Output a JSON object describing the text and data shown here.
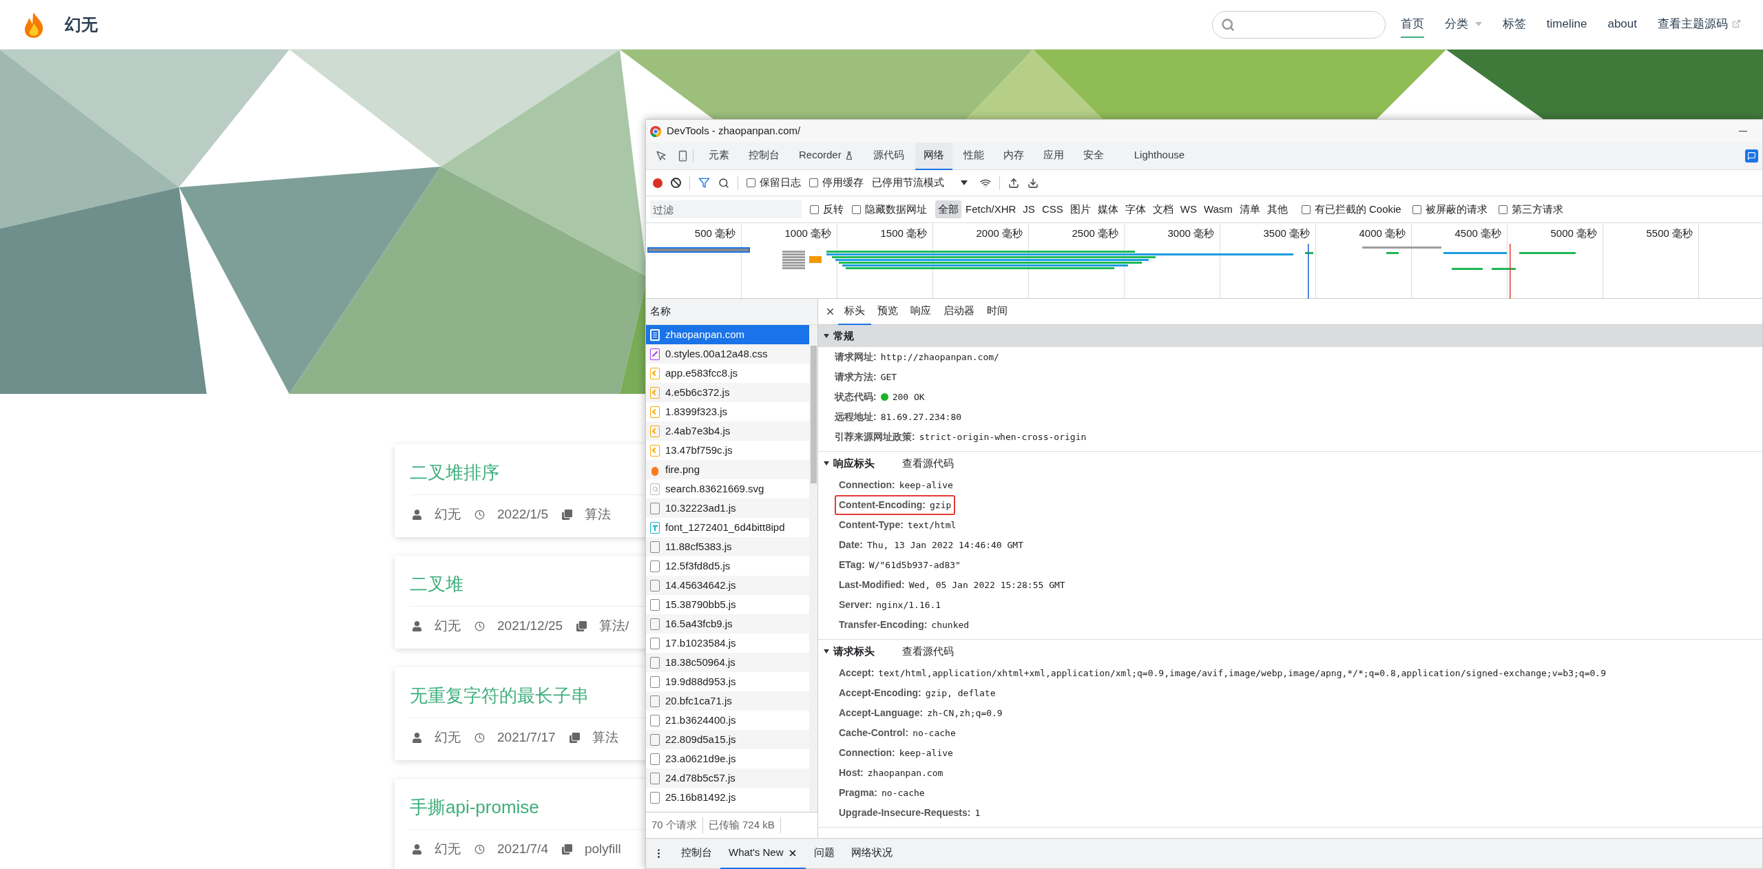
{
  "site": {
    "title": "幻无",
    "nav": [
      {
        "label": "首页",
        "selected": true,
        "kind": "link"
      },
      {
        "label": "分类",
        "selected": false,
        "kind": "dropdown"
      },
      {
        "label": "标签",
        "selected": false,
        "kind": "link"
      },
      {
        "label": "timeline",
        "selected": false,
        "kind": "link"
      },
      {
        "label": "about",
        "selected": false,
        "kind": "link"
      },
      {
        "label": "查看主题源码",
        "selected": false,
        "kind": "external"
      }
    ]
  },
  "posts": [
    {
      "title": "二叉堆排序",
      "author": "幻无",
      "date": "2022/1/5",
      "category": "算法"
    },
    {
      "title": "二叉堆",
      "author": "幻无",
      "date": "2021/12/25",
      "category": "算法/"
    },
    {
      "title": "无重复字符的最长子串",
      "author": "幻无",
      "date": "2021/7/17",
      "category": "算法"
    },
    {
      "title": "手撕api-promise",
      "author": "幻无",
      "date": "2021/7/4",
      "category": "polyfill"
    }
  ],
  "devtools": {
    "title": "DevTools - zhaopanpan.com/",
    "tabs": [
      {
        "label": "元素",
        "selected": false,
        "kind": "plain"
      },
      {
        "label": "控制台",
        "selected": false,
        "kind": "plain"
      },
      {
        "label": "Recorder",
        "selected": false,
        "kind": "experimental"
      },
      {
        "label": "源代码",
        "selected": false,
        "kind": "plain"
      },
      {
        "label": "网络",
        "selected": true,
        "kind": "plain"
      },
      {
        "label": "性能",
        "selected": false,
        "kind": "plain"
      },
      {
        "label": "内存",
        "selected": false,
        "kind": "plain"
      },
      {
        "label": "应用",
        "selected": false,
        "kind": "plain"
      },
      {
        "label": "安全",
        "selected": false,
        "kind": "plain"
      },
      {
        "label": "Lighthouse",
        "selected": false,
        "kind": "plain"
      }
    ],
    "toolbar": {
      "recording": true,
      "filter_active": true,
      "checkboxes": [
        {
          "label": "保留日志",
          "checked": false
        },
        {
          "label": "停用缓存",
          "checked": false
        }
      ],
      "throttle": "已停用节流模式"
    },
    "filter": {
      "placeholder": "过滤",
      "options": [
        {
          "label": "反转",
          "checked": false
        },
        {
          "label": "隐藏数据网址",
          "checked": false
        }
      ],
      "types": [
        {
          "label": "全部",
          "selected": true
        },
        {
          "label": "Fetch/XHR",
          "selected": false
        },
        {
          "label": "JS",
          "selected": false
        },
        {
          "label": "CSS",
          "selected": false
        },
        {
          "label": "图片",
          "selected": false
        },
        {
          "label": "媒体",
          "selected": false
        },
        {
          "label": "字体",
          "selected": false
        },
        {
          "label": "文档",
          "selected": false
        },
        {
          "label": "WS",
          "selected": false
        },
        {
          "label": "Wasm",
          "selected": false
        },
        {
          "label": "清单",
          "selected": false
        },
        {
          "label": "其他",
          "selected": false
        }
      ],
      "more_options": [
        {
          "label": "有已拦截的 Cookie",
          "checked": false
        },
        {
          "label": "被屏蔽的请求",
          "checked": false
        },
        {
          "label": "第三方请求",
          "checked": false
        }
      ]
    },
    "timeline": {
      "ticks": [
        "500 毫秒",
        "1000 毫秒",
        "1500 毫秒",
        "2000 毫秒",
        "2500 毫秒",
        "3000 毫秒",
        "3500 毫秒",
        "4000 毫秒",
        "4500 毫秒",
        "5000 毫秒",
        "5500 毫秒"
      ]
    },
    "requests": {
      "header": "名称",
      "items": [
        {
          "name": "zhaopanpan.com",
          "kind": "document",
          "selected": true
        },
        {
          "name": "0.styles.00a12a48.css",
          "kind": "stylesheet",
          "selected": false
        },
        {
          "name": "app.e583fcc8.js",
          "kind": "script",
          "selected": false
        },
        {
          "name": "4.e5b6c372.js",
          "kind": "script",
          "selected": false
        },
        {
          "name": "1.8399f323.js",
          "kind": "script",
          "selected": false
        },
        {
          "name": "2.4ab7e3b4.js",
          "kind": "script",
          "selected": false
        },
        {
          "name": "13.47bf759c.js",
          "kind": "script",
          "selected": false
        },
        {
          "name": "fire.png",
          "selected": false
        },
        {
          "name": "search.83621669.svg",
          "kind": "svg",
          "selected": false
        },
        {
          "name": "10.32223ad1.js",
          "kind": "other",
          "selected": false
        },
        {
          "name": "font_1272401_6d4bitt8ipd",
          "kind": "font",
          "selected": false
        },
        {
          "name": "11.88cf5383.js",
          "kind": "other",
          "selected": false
        },
        {
          "name": "12.5f3fd8d5.js",
          "kind": "other",
          "selected": false
        },
        {
          "name": "14.45634642.js",
          "kind": "other",
          "selected": false
        },
        {
          "name": "15.38790bb5.js",
          "kind": "other",
          "selected": false
        },
        {
          "name": "16.5a43fcb9.js",
          "kind": "other",
          "selected": false
        },
        {
          "name": "17.b1023584.js",
          "kind": "other",
          "selected": false
        },
        {
          "name": "18.38c50964.js",
          "kind": "other",
          "selected": false
        },
        {
          "name": "19.9d88d953.js",
          "kind": "other",
          "selected": false
        },
        {
          "name": "20.bfc1ca71.js",
          "kind": "other",
          "selected": false
        },
        {
          "name": "21.b3624400.js",
          "kind": "other",
          "selected": false
        },
        {
          "name": "22.809d5a15.js",
          "kind": "other",
          "selected": false
        },
        {
          "name": "23.a0621d9e.js",
          "kind": "other",
          "selected": false
        },
        {
          "name": "24.d78b5c57.js",
          "kind": "other",
          "selected": false
        },
        {
          "name": "25.16b81492.js",
          "kind": "other",
          "selected": false
        }
      ],
      "summary": [
        "70 个请求",
        "已传输 724 kB"
      ]
    },
    "details": {
      "tabs": [
        {
          "label": "标头",
          "selected": true
        },
        {
          "label": "预览",
          "selected": false
        },
        {
          "label": "响应",
          "selected": false
        },
        {
          "label": "启动器",
          "selected": false
        },
        {
          "label": "时间",
          "selected": false
        }
      ],
      "general": {
        "title": "常规",
        "focused": true,
        "rows": [
          {
            "name": "请求网址:",
            "value": "http://zhaopanpan.com/",
            "kind": "text"
          },
          {
            "name": "请求方法:",
            "value": "GET",
            "kind": "text"
          },
          {
            "name": "状态代码:",
            "value": "200 OK",
            "kind": "status"
          },
          {
            "name": "远程地址:",
            "value": "81.69.27.234:80",
            "kind": "text"
          },
          {
            "name": "引荐来源网址政策:",
            "value": "strict-origin-when-cross-origin",
            "kind": "text"
          }
        ]
      },
      "sections": [
        {
          "title": "响应标头",
          "focused": false,
          "view_source": "查看源代码",
          "rows": [
            {
              "name": "Connection:",
              "value": "keep-alive",
              "highlighted": false
            },
            {
              "name": "Content-Encoding:",
              "value": "gzip",
              "highlighted": true
            },
            {
              "name": "Content-Type:",
              "value": "text/html",
              "highlighted": false
            },
            {
              "name": "Date:",
              "value": "Thu, 13 Jan 2022 14:46:40 GMT",
              "highlighted": false
            },
            {
              "name": "ETag:",
              "value": "W/\"61d5b937-ad83\"",
              "highlighted": false
            },
            {
              "name": "Last-Modified:",
              "value": "Wed, 05 Jan 2022 15:28:55 GMT",
              "highlighted": false
            },
            {
              "name": "Server:",
              "value": "nginx/1.16.1",
              "highlighted": false
            },
            {
              "name": "Transfer-Encoding:",
              "value": "chunked",
              "highlighted": false
            }
          ]
        },
        {
          "title": "请求标头",
          "focused": false,
          "view_source": "查看源代码",
          "rows": [
            {
              "name": "Accept:",
              "value": "text/html,application/xhtml+xml,application/xml;q=0.9,image/avif,image/webp,image/apng,*/*;q=0.8,application/signed-exchange;v=b3;q=0.9",
              "highlighted": false
            },
            {
              "name": "Accept-Encoding:",
              "value": "gzip, deflate",
              "highlighted": false
            },
            {
              "name": "Accept-Language:",
              "value": "zh-CN,zh;q=0.9",
              "highlighted": false
            },
            {
              "name": "Cache-Control:",
              "value": "no-cache",
              "highlighted": false
            },
            {
              "name": "Connection:",
              "value": "keep-alive",
              "highlighted": false
            },
            {
              "name": "Host:",
              "value": "zhaopanpan.com",
              "highlighted": false
            },
            {
              "name": "Pragma:",
              "value": "no-cache",
              "highlighted": false
            },
            {
              "name": "Upgrade-Insecure-Requests:",
              "value": "1",
              "highlighted": false
            }
          ]
        }
      ]
    },
    "drawer": {
      "tabs": [
        {
          "label": "控制台",
          "selected": false,
          "closable": false
        },
        {
          "label": "What's New",
          "selected": true,
          "closable": true
        },
        {
          "label": "问题",
          "selected": false,
          "closable": false
        },
        {
          "label": "网络状况",
          "selected": false,
          "closable": false
        }
      ]
    }
  }
}
